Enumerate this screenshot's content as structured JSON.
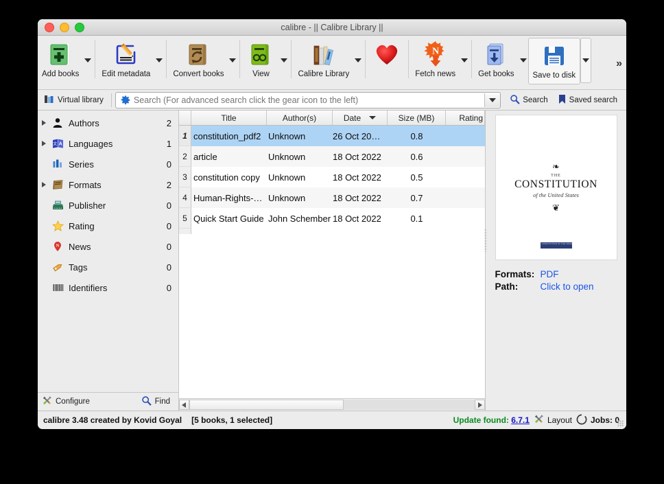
{
  "window": {
    "title": "calibre - || Calibre Library ||",
    "controls": [
      "close",
      "minimize",
      "zoom"
    ]
  },
  "toolbar": {
    "overflow_label": "»",
    "items": [
      {
        "label": "Add books",
        "icon": "add-books-icon",
        "has_caret": true,
        "framed": false
      },
      {
        "label": "Edit metadata",
        "icon": "edit-metadata-icon",
        "has_caret": true,
        "framed": false
      },
      {
        "label": "Convert books",
        "icon": "convert-books-icon",
        "has_caret": true,
        "framed": false
      },
      {
        "label": "View",
        "icon": "view-icon",
        "has_caret": true,
        "framed": false
      },
      {
        "label": "Calibre Library",
        "icon": "calibre-library-icon",
        "has_caret": true,
        "framed": false
      },
      {
        "label": "",
        "icon": "heart-icon",
        "has_caret": false,
        "framed": false
      },
      {
        "label": "Fetch news",
        "icon": "fetch-news-icon",
        "has_caret": true,
        "framed": false
      },
      {
        "label": "Get books",
        "icon": "get-books-icon",
        "has_caret": true,
        "framed": false
      },
      {
        "label": "Save to disk",
        "icon": "save-to-disk-icon",
        "has_caret": true,
        "framed": true
      }
    ]
  },
  "search": {
    "virtual_library_label": "Virtual library",
    "placeholder": "Search (For advanced search click the gear icon to the left)",
    "value": "",
    "search_button_label": "Search",
    "saved_search_label": "Saved search"
  },
  "sidebar": {
    "items": [
      {
        "label": "Authors",
        "count": "2",
        "icon": "person-icon",
        "expandable": true
      },
      {
        "label": "Languages",
        "count": "1",
        "icon": "languages-icon",
        "expandable": true
      },
      {
        "label": "Series",
        "count": "0",
        "icon": "series-icon",
        "expandable": false
      },
      {
        "label": "Formats",
        "count": "2",
        "icon": "formats-icon",
        "expandable": true
      },
      {
        "label": "Publisher",
        "count": "0",
        "icon": "publisher-icon",
        "expandable": false
      },
      {
        "label": "Rating",
        "count": "0",
        "icon": "star-icon",
        "expandable": false
      },
      {
        "label": "News",
        "count": "0",
        "icon": "news-icon",
        "expandable": false
      },
      {
        "label": "Tags",
        "count": "0",
        "icon": "tag-icon",
        "expandable": false
      },
      {
        "label": "Identifiers",
        "count": "0",
        "icon": "identifiers-icon",
        "expandable": false
      }
    ],
    "configure_label": "Configure",
    "find_label": "Find"
  },
  "book_table": {
    "columns": [
      "Title",
      "Author(s)",
      "Date",
      "Size (MB)",
      "Rating"
    ],
    "sorted_column": "Date",
    "sort_direction": "descending",
    "rows": [
      {
        "num": "1",
        "title": "constitution_pdf2",
        "author": "Unknown",
        "date": "26 Oct 20…",
        "size": "0.8",
        "rating": "",
        "selected": true
      },
      {
        "num": "2",
        "title": "article",
        "author": "Unknown",
        "date": "18 Oct 2022",
        "size": "0.6",
        "rating": "",
        "selected": false
      },
      {
        "num": "3",
        "title": "constitution copy",
        "author": "Unknown",
        "date": "18 Oct 2022",
        "size": "0.5",
        "rating": "",
        "selected": false
      },
      {
        "num": "4",
        "title": "Human-Rights-…",
        "author": "Unknown",
        "date": "18 Oct 2022",
        "size": "0.7",
        "rating": "",
        "selected": false
      },
      {
        "num": "5",
        "title": "Quick Start Guide",
        "author": "John Schember",
        "date": "18 Oct 2022",
        "size": "0.1",
        "rating": "",
        "selected": false
      }
    ]
  },
  "detail": {
    "cover": {
      "the": "THE",
      "title": "CONSTITUTION",
      "subtitle": "of the United States",
      "flourish_top": "❧",
      "flourish_bottom": "❦",
      "banner_text": "CONSTITUTION OF THE UNITED STATES"
    },
    "formats_key": "Formats:",
    "formats_value": "PDF",
    "path_key": "Path:",
    "path_value": "Click to open"
  },
  "statusbar": {
    "version_text": "calibre 3.48 created by Kovid Goyal",
    "selection_text": "[5 books, 1 selected]",
    "update_prefix": "Update found:",
    "update_version": "6.7.1",
    "layout_label": "Layout",
    "jobs_label": "Jobs: 0"
  }
}
